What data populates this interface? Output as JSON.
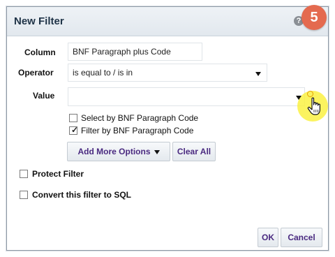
{
  "dialog": {
    "title": "New Filter",
    "help_icon": "?",
    "step_badge": "5"
  },
  "form": {
    "column_label": "Column",
    "column_value": "BNF Paragraph plus Code",
    "operator_label": "Operator",
    "operator_value": "is equal to / is in",
    "value_label": "Value",
    "value_value": ""
  },
  "options": [
    {
      "label": "Select by BNF Paragraph Code",
      "checked": false
    },
    {
      "label": "Filter by BNF Paragraph Code",
      "checked": true
    }
  ],
  "buttons": {
    "add_more_options": "Add More Options",
    "clear_all": "Clear All",
    "ok": "OK",
    "cancel": "Cancel"
  },
  "toggles": {
    "protect_filter": {
      "label": "Protect Filter",
      "checked": false
    },
    "convert_to_sql": {
      "label": "Convert this filter to SQL",
      "checked": false
    }
  },
  "icons": {
    "help": "question-circle-icon",
    "dropdown": "triangle-down-icon",
    "cursor": "hand-pointer-icon",
    "check": "checkmark-icon"
  },
  "colors": {
    "button_text": "#4a2a80",
    "step_badge": "#e46a4f",
    "cursor_highlight": "#faf03c"
  }
}
